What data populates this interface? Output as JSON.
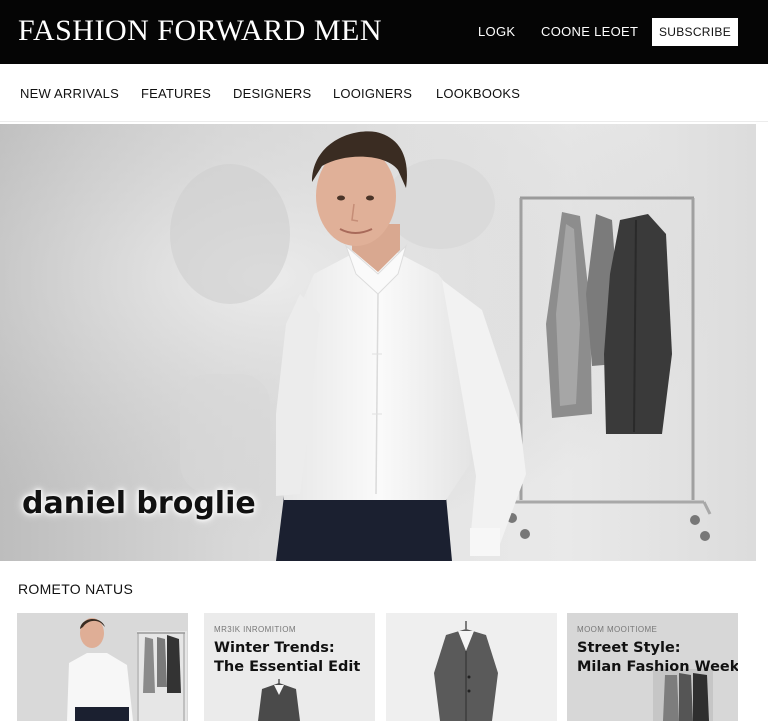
{
  "header": {
    "brand": "FASHION FORWARD MEN",
    "links": [
      "LOGK",
      "COONE LEOET"
    ],
    "subscribe_label": "SUBSCRIBE"
  },
  "nav": {
    "items": [
      "NEW ARRIVALS",
      "FEATURES",
      "DESIGNERS",
      "LOOIGNERS",
      "LOOKBOOKS"
    ]
  },
  "hero": {
    "caption": "daniel broglie"
  },
  "section": {
    "title": "ROMETO NATUS"
  },
  "cards": [
    {
      "kicker": "",
      "title_line1": "",
      "title_line2": ""
    },
    {
      "kicker": "MR3IK INROMITIOM",
      "title_line1": "Winter Trends:",
      "title_line2": "The Essential Edit"
    },
    {
      "kicker": "",
      "title_line1": "",
      "title_line2": ""
    },
    {
      "kicker": "MOOM MOOITIOME",
      "title_line1": "Street Style:",
      "title_line2": "Milan Fashion Week"
    }
  ],
  "colors": {
    "topbar": "#050505",
    "shirt": "#f7f7f7",
    "trousers": "#1b2030",
    "coat": "#3a3a3a"
  }
}
